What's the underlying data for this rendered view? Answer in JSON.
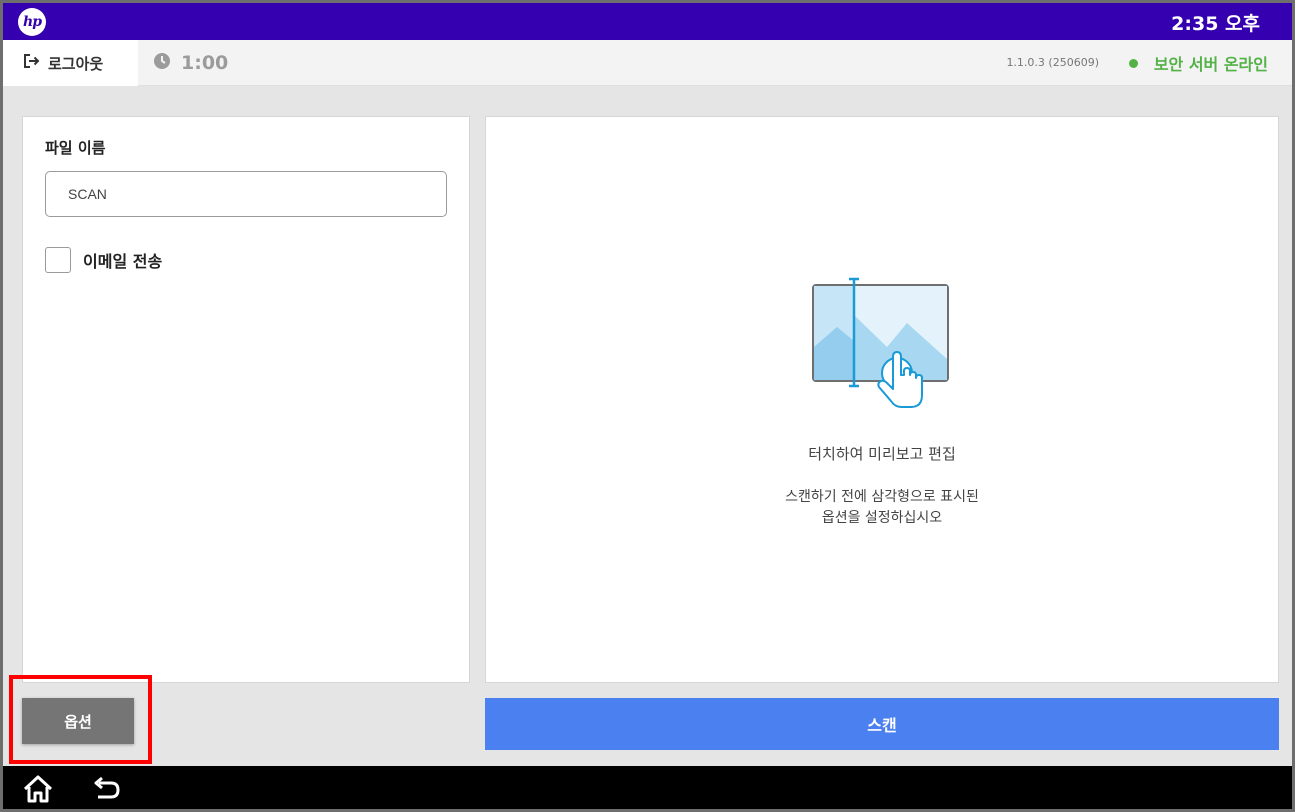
{
  "header": {
    "logo_text": "hp",
    "clock": "2:35 오후"
  },
  "subbar": {
    "logout_label": "로그아웃",
    "timer": "1:00",
    "version": "1.1.0.3 (250609)",
    "server_status": "보안 서버 온라인",
    "status_color": "#53b146"
  },
  "form": {
    "filename_label": "파일 이름",
    "filename_value": "SCAN",
    "email_label": "이메일 전송",
    "email_checked": false
  },
  "preview": {
    "title": "터치하여 미리보고 편집",
    "desc_line1": "스캔하기 전에 삼각형으로 표시된",
    "desc_line2": "옵션을 설정하십시오",
    "icon": "scan-preview-touch-icon"
  },
  "actions": {
    "options_label": "옵션",
    "scan_label": "스캔"
  },
  "nav": {
    "home_icon": "home-icon",
    "back_icon": "back-icon"
  },
  "colors": {
    "topbar": "#3400b0",
    "scan_button": "#4a80ef",
    "options_button": "#757575",
    "highlight": "#ff0000"
  }
}
